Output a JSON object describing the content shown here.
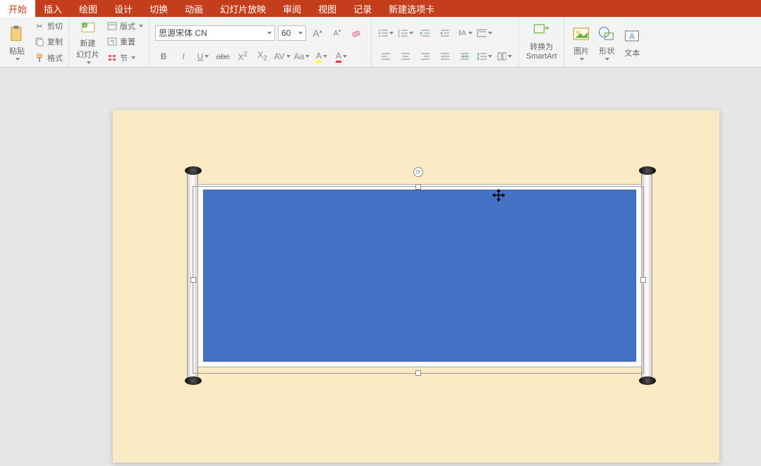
{
  "tabs": {
    "start": "开始",
    "insert": "插入",
    "draw": "绘图",
    "design": "设计",
    "transition": "切换",
    "animation": "动画",
    "slideshow": "幻灯片放映",
    "review": "审阅",
    "view": "视图",
    "record": "记录",
    "newtab": "新建选项卡"
  },
  "ribbon": {
    "paste": "粘贴",
    "cut": "剪切",
    "copy": "复制",
    "format": "格式",
    "newslide": "新建\n幻灯片",
    "layout": "版式",
    "reset": "重置",
    "section": "节",
    "font_name": "思源宋体 CN",
    "font_size": "60",
    "smartart": "转换为\nSmartArt",
    "picture": "图片",
    "shape": "形状",
    "textbox": "文本"
  },
  "rotation_symbol": "⟳"
}
